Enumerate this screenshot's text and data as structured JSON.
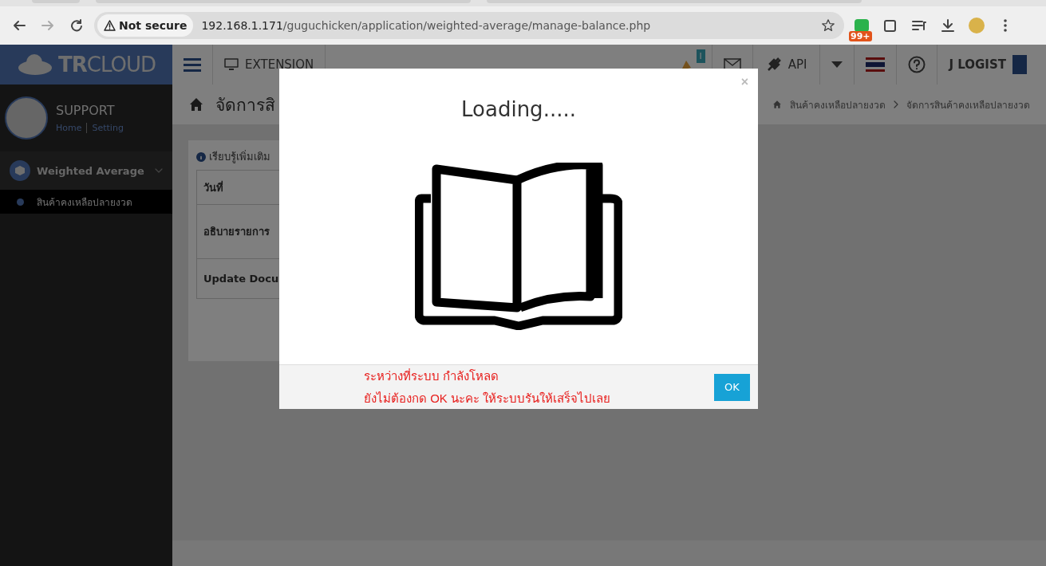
{
  "browser": {
    "security_label": "Not secure",
    "url_host": "192.168.1.171",
    "url_path": "/guguchicken/application/weighted-average/manage-balance.php",
    "extension_badge": "99+"
  },
  "header": {
    "logo_bold": "TR",
    "logo_rest": "CLOUD",
    "extension": "EXTENSION",
    "notification_badge": "I",
    "api": "API",
    "user": "J LOGIST"
  },
  "sidebar": {
    "user_name": "SUPPORT",
    "links": [
      "Home",
      "Setting"
    ],
    "menu": [
      {
        "label": "Weighted Average",
        "expanded": true,
        "children": [
          {
            "label": "สินค้าคงเหลือปลายงวด",
            "selected": true
          }
        ]
      }
    ]
  },
  "page": {
    "title": "จัดการสิ",
    "breadcrumb": [
      "สินค้าคงเหลือปลายงวด",
      "จัดการสินค้าคงเหลือปลายงวด"
    ],
    "info": "เรียบรู้เพิ่มเติม",
    "form_rows": [
      "วันที่",
      "อธิบายรายการ",
      "Update Docu"
    ]
  },
  "modal": {
    "title": "Loading.....",
    "close": "×",
    "messages": [
      "ระหว่างที่ระบบ กำลังโหลด",
      "ยังไม่ต้องกด OK นะคะ ให้ระบบรันให้เสร็จไปเลย"
    ],
    "ok_button": "OK"
  }
}
